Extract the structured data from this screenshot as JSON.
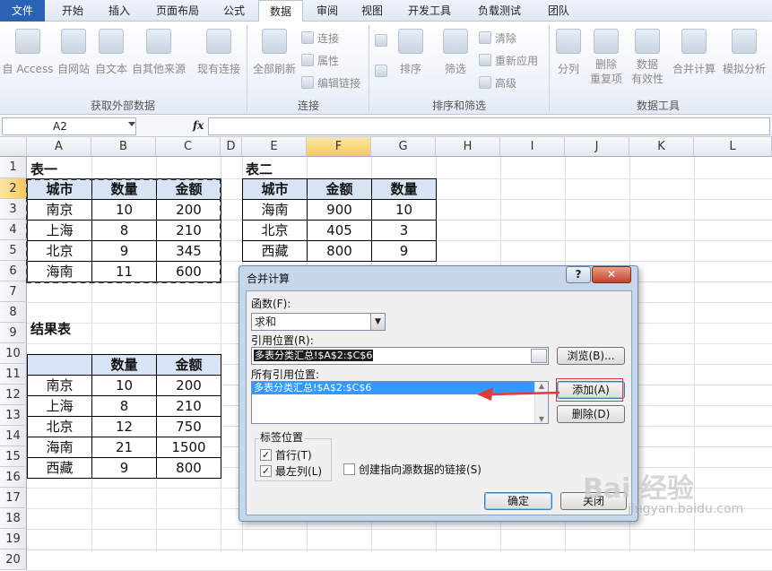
{
  "tabs": [
    "文件",
    "开始",
    "插入",
    "页面布局",
    "公式",
    "数据",
    "审阅",
    "视图",
    "开发工具",
    "负载测试",
    "团队"
  ],
  "ribbon": {
    "ext_group": {
      "label": "获取外部数据",
      "items": [
        "自 Access",
        "自网站",
        "自文本",
        "自其他来源",
        "现有连接"
      ]
    },
    "conn_group": {
      "label": "连接",
      "refresh": "全部刷新",
      "small": [
        "连接",
        "属性",
        "编辑链接"
      ]
    },
    "sort_group": {
      "label": "排序和筛选",
      "sort": "排序",
      "filter": "筛选",
      "small": [
        "清除",
        "重新应用",
        "高级"
      ]
    },
    "tools_group": {
      "label": "数据工具",
      "items": [
        "分列",
        "删除\n重复项",
        "数据\n有效性",
        "合并计算",
        "模拟分析"
      ]
    }
  },
  "formula_bar": {
    "namebox": "A2",
    "fx": "fx",
    "formula": ""
  },
  "grid": {
    "columns": [
      "A",
      "B",
      "C",
      "D",
      "E",
      "F",
      "G",
      "H",
      "I",
      "J",
      "K",
      "L"
    ],
    "rows": [
      "1",
      "2",
      "3",
      "4",
      "5",
      "6",
      "7",
      "8",
      "9",
      "10",
      "11",
      "12",
      "13",
      "14",
      "15",
      "16",
      "17",
      "18",
      "19",
      "20"
    ],
    "table1": {
      "title": "表一",
      "header": [
        "城市",
        "数量",
        "金额"
      ],
      "rows": [
        [
          "南京",
          "10",
          "200"
        ],
        [
          "上海",
          "8",
          "210"
        ],
        [
          "北京",
          "9",
          "345"
        ],
        [
          "海南",
          "11",
          "600"
        ]
      ]
    },
    "table2": {
      "title": "表二",
      "header": [
        "城市",
        "金额",
        "数量"
      ],
      "rows": [
        [
          "海南",
          "900",
          "10"
        ],
        [
          "北京",
          "405",
          "3"
        ],
        [
          "西藏",
          "800",
          "9"
        ]
      ]
    },
    "result": {
      "title": "结果表",
      "header": [
        "",
        "数量",
        "金额"
      ],
      "rows": [
        [
          "南京",
          "10",
          "200"
        ],
        [
          "上海",
          "8",
          "210"
        ],
        [
          "北京",
          "12",
          "750"
        ],
        [
          "海南",
          "21",
          "1500"
        ],
        [
          "西藏",
          "9",
          "800"
        ]
      ]
    }
  },
  "dialog": {
    "title": "合并计算",
    "help": "?",
    "close": "✕",
    "function_label": "函数(F):",
    "function_value": "求和",
    "ref_label": "引用位置(R):",
    "ref_value": "多表分类汇总!$A$2:$C$6",
    "browse": "浏览(B)...",
    "all_refs_label": "所有引用位置:",
    "all_refs_item": "多表分类汇总!$A$2:$C$6",
    "add": "添加(A)",
    "delete": "删除(D)",
    "labels_group": "标签位置",
    "first_row": "首行(T)",
    "left_col": "最左列(L)",
    "create_links": "创建指向源数据的链接(S)",
    "ok": "确定",
    "close_btn": "关闭"
  },
  "watermark": {
    "text": "Bai 经验",
    "url": "jingyan.baidu.com"
  },
  "colors": {
    "accent_red": "#e23a3a",
    "selection": "#3399ff",
    "header_fill": "#d7e4f4"
  }
}
